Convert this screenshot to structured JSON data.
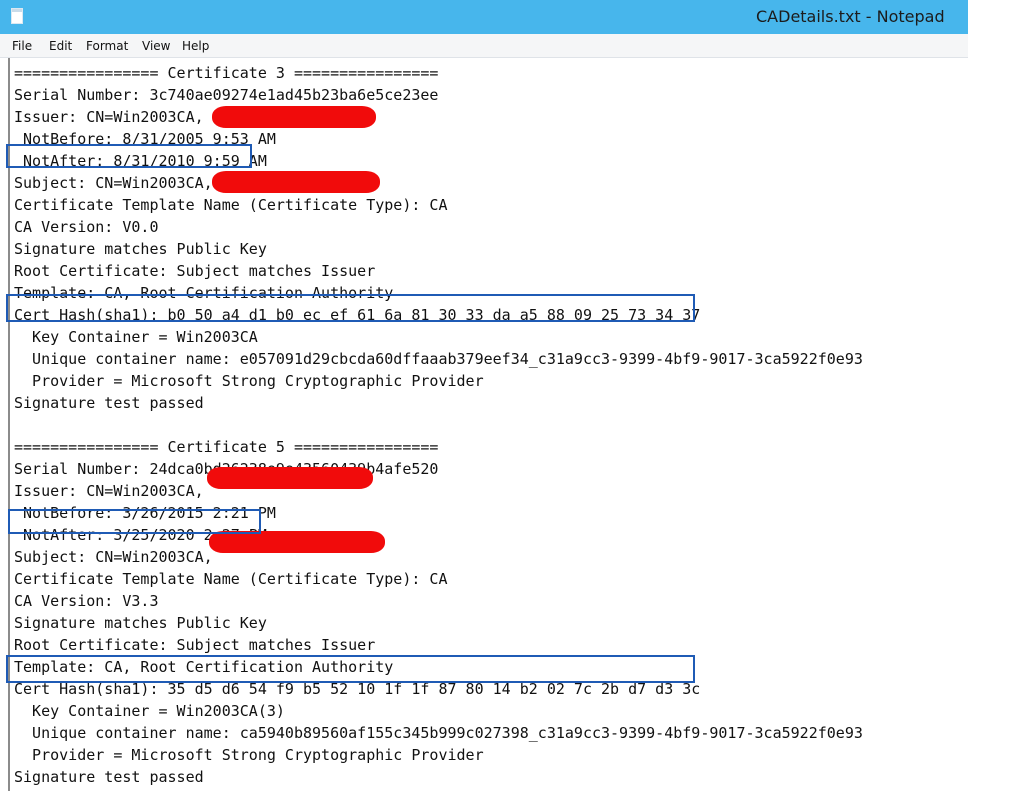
{
  "window": {
    "title": "CADetails.txt - Notepad"
  },
  "menu": {
    "file": "File",
    "edit": "Edit",
    "format": "Format",
    "view": "View",
    "help": "Help"
  },
  "document": {
    "lines": [
      "================ Certificate 3 ================",
      "Serial Number: 3c740ae09274e1ad45b23ba6e5ce23ee",
      "Issuer: CN=Win2003CA,",
      " NotBefore: 8/31/2005 9:53 AM",
      " NotAfter: 8/31/2010 9:59 AM",
      "Subject: CN=Win2003CA,",
      "Certificate Template Name (Certificate Type): CA",
      "CA Version: V0.0",
      "Signature matches Public Key",
      "Root Certificate: Subject matches Issuer",
      "Template: CA, Root Certification Authority",
      "Cert Hash(sha1): b0 50 a4 d1 b0 ec ef 61 6a 81 30 33 da a5 88 09 25 73 34 37",
      "  Key Container = Win2003CA",
      "  Unique container name: e057091d29cbcda60dffaaab379eef34_c31a9cc3-9399-4bf9-9017-3ca5922f0e93",
      "  Provider = Microsoft Strong Cryptographic Provider",
      "Signature test passed",
      "",
      "================ Certificate 5 ================",
      "Serial Number: 24dca0bd26238e9e43560439b4afe520",
      "Issuer: CN=Win2003CA,",
      " NotBefore: 3/26/2015 2:21 PM",
      " NotAfter: 3/25/2020 2:27 PM",
      "Subject: CN=Win2003CA,",
      "Certificate Template Name (Certificate Type): CA",
      "CA Version: V3.3",
      "Signature matches Public Key",
      "Root Certificate: Subject matches Issuer",
      "Template: CA, Root Certification Authority",
      "Cert Hash(sha1): 35 d5 d6 54 f9 b5 52 10 1f 1f 87 80 14 b2 02 7c 2b d7 d3 3c",
      "  Key Container = Win2003CA(3)",
      "  Unique container name: ca5940b89560af155c345b999c027398_c31a9cc3-9399-4bf9-9017-3ca5922f0e93",
      "  Provider = Microsoft Strong Cryptographic Provider",
      "Signature test passed"
    ]
  },
  "colors": {
    "titlebar": "#47b6ec",
    "menubar": "#f5f6f7",
    "text": "#111111",
    "highlight": "#1f5bb5",
    "redaction": "#f10b0b"
  },
  "icons": {
    "app": "notepad-icon"
  }
}
